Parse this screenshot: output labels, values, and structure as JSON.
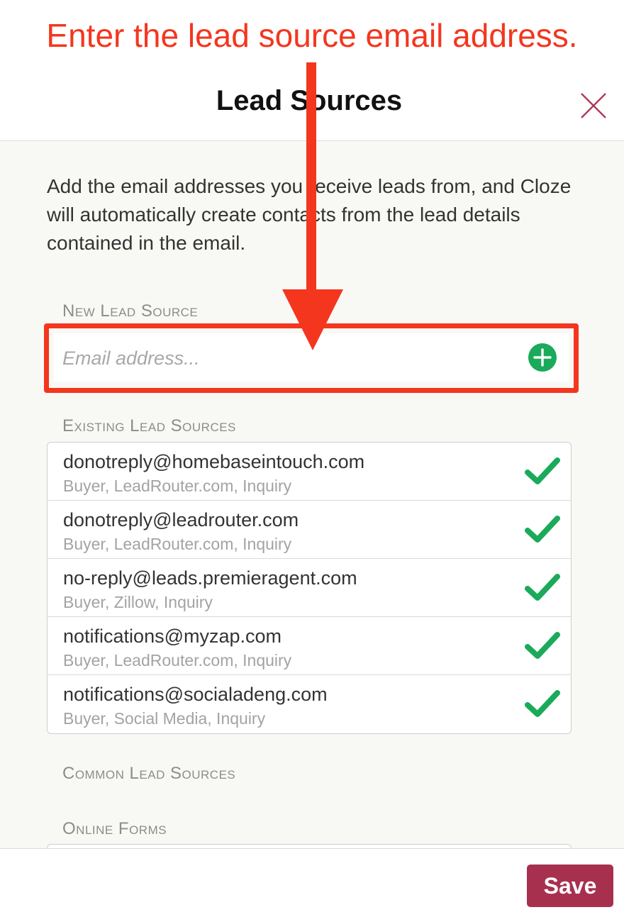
{
  "annotation": {
    "caption": "Enter the lead source email address.",
    "color": "#f4361e"
  },
  "dialog": {
    "title": "Lead Sources",
    "close_icon": "close-icon",
    "description": "Add the email addresses you receive leads from, and Cloze will automatically create contacts from the lead details contained in the email."
  },
  "new_lead_source": {
    "label": "New Lead Source",
    "placeholder": "Email address...",
    "value": "",
    "add_icon": "plus-circle-icon",
    "accent_color": "#1aaa5a"
  },
  "existing_lead_sources": {
    "label": "Existing Lead Sources",
    "items": [
      {
        "email": "donotreply@homebaseintouch.com",
        "details": "Buyer, LeadRouter.com, Inquiry",
        "status_icon": "check-icon"
      },
      {
        "email": "donotreply@leadrouter.com",
        "details": "Buyer, LeadRouter.com, Inquiry",
        "status_icon": "check-icon"
      },
      {
        "email": "no-reply@leads.premieragent.com",
        "details": "Buyer, Zillow, Inquiry",
        "status_icon": "check-icon"
      },
      {
        "email": "notifications@myzap.com",
        "details": "Buyer, LeadRouter.com, Inquiry",
        "status_icon": "check-icon"
      },
      {
        "email": "notifications@socialadeng.com",
        "details": "Buyer, Social Media, Inquiry",
        "status_icon": "check-icon"
      }
    ]
  },
  "common_lead_sources": {
    "label": "Common Lead Sources"
  },
  "online_forms": {
    "label": "Online Forms"
  },
  "footer": {
    "save_label": "Save",
    "save_color": "#a8304f"
  }
}
